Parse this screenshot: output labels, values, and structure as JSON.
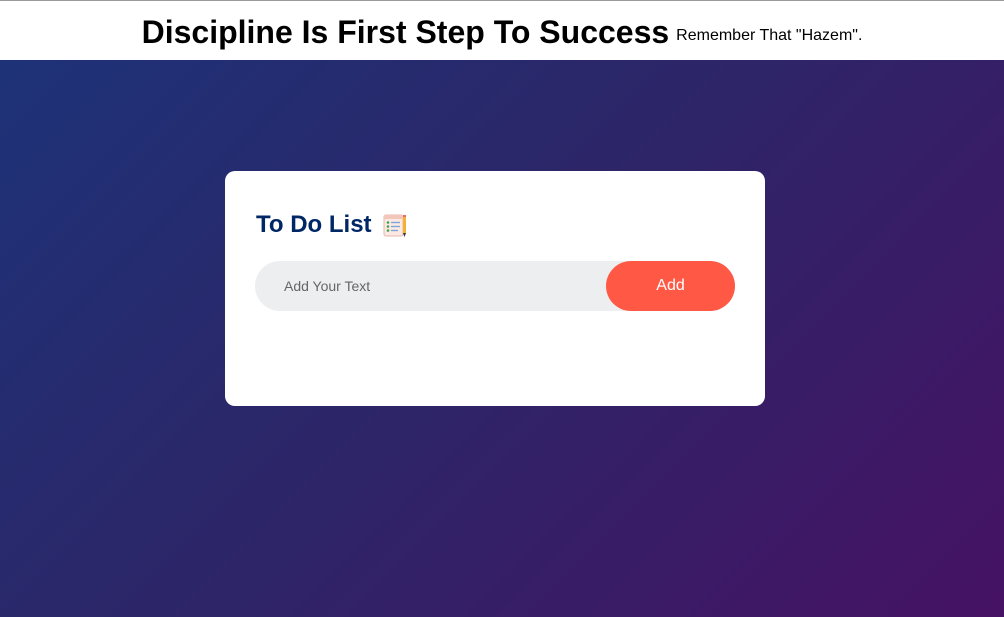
{
  "header": {
    "headline": "Discipline Is First Step To Success",
    "subline": "Remember That \"Hazem\"."
  },
  "todo": {
    "title": "To Do List",
    "title_icon": "notepad-checklist-icon",
    "input_placeholder": "Add Your Text",
    "input_value": "",
    "add_label": "Add"
  },
  "colors": {
    "title": "#002765",
    "add_button": "#ff5945",
    "input_bg": "#edeef0",
    "gradient_start": "#1e3278",
    "gradient_end": "#461264"
  }
}
